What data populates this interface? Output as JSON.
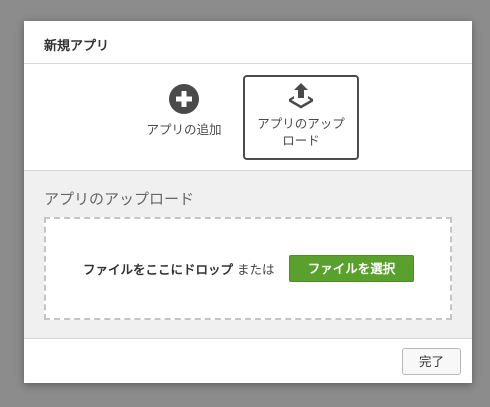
{
  "dialog": {
    "title": "新規アプリ"
  },
  "choices": {
    "add": {
      "icon": "plus-circle-icon",
      "label": "アプリの追加"
    },
    "upload": {
      "icon": "upload-tray-icon",
      "label_line1": "アプリのアップ",
      "label_line2": "ロード"
    }
  },
  "upload_panel": {
    "title": "アプリのアップロード",
    "drop_text": "ファイルをここにドロップ",
    "or_text": "または",
    "select_button": "ファイルを選択"
  },
  "footer": {
    "done_button": "完了"
  },
  "colors": {
    "overlay": "#8c8c8c",
    "accent_green": "#5aa02c",
    "panel_bg": "#f0f0f0",
    "selected_border": "#4b4b4b"
  }
}
